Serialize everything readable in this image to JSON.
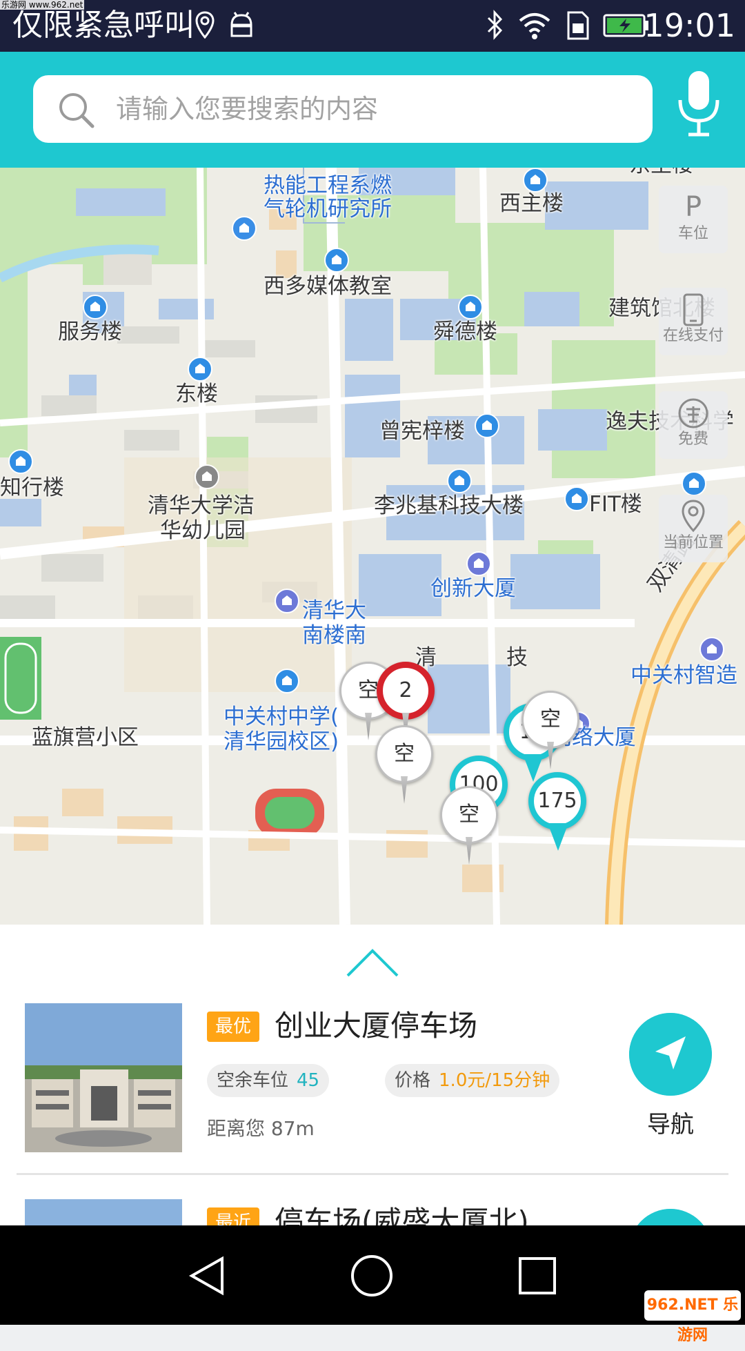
{
  "watermark": "乐游网 www.962.net",
  "status_bar": {
    "title": "仅限紧急呼叫",
    "time": "19:01",
    "icons": [
      "location-icon",
      "android-icon",
      "bluetooth-icon",
      "wifi-icon",
      "sim-icon",
      "battery-icon"
    ]
  },
  "search": {
    "placeholder": "请输入您要搜索的内容",
    "icon": "search-icon",
    "voice_icon": "microphone-icon"
  },
  "map": {
    "labels": [
      "热能工程系燃",
      "气轮机研究所",
      "西主楼",
      "东主楼",
      "西多媒体教室",
      "服务楼",
      "舜德楼",
      "建筑馆北楼",
      "东楼",
      "曾宪梓楼",
      "逸夫技术科学",
      "知行楼",
      "清华大学洁",
      "华幼儿园",
      "李兆基科技大楼",
      "FIT楼",
      "双清路",
      "创新大厦",
      "清华大",
      "南楼南",
      "中关村智造",
      "中关村中学(",
      "清华园校区)",
      "蓝旗营小区",
      "搜狐网络大厦",
      "清",
      "技"
    ],
    "side_buttons": [
      {
        "label": "车位",
        "icon": "parking-icon"
      },
      {
        "label": "在线支付",
        "icon": "phone-icon"
      },
      {
        "label": "免费",
        "icon": "free-icon"
      },
      {
        "label": "当前位置",
        "icon": "location-pin-icon"
      }
    ],
    "markers": [
      {
        "text": "空",
        "style": "gray"
      },
      {
        "text": "2",
        "style": "red"
      },
      {
        "text": "空",
        "style": "gray"
      },
      {
        "text": "19",
        "style": "teal"
      },
      {
        "text": "空",
        "style": "gray"
      },
      {
        "text": "100",
        "style": "teal"
      },
      {
        "text": "空",
        "style": "gray"
      },
      {
        "text": "175",
        "style": "teal"
      }
    ]
  },
  "panel": {
    "expand_icon": "chevron-up-icon",
    "cards": [
      {
        "badge": "最优",
        "name": "创业大厦停车场",
        "free_label": "空余车位",
        "free_value": "45",
        "price_label": "价格",
        "price_value": "1.0元/15分钟",
        "distance": "距离您 87m",
        "nav_label": "导航"
      },
      {
        "badge": "最近",
        "name": "停车场(威盛大厦北)"
      }
    ]
  },
  "navbar": {
    "buttons": [
      "back-icon",
      "home-icon",
      "recents-icon"
    ],
    "brand": "962.NET 乐游网"
  },
  "colors": {
    "accent": "#1ec8d0",
    "status_bar": "#1b1f3b",
    "badge": "#ffa415",
    "price": "#f29a0d",
    "free_count": "#20b3bf",
    "marker_red": "#d5232c"
  }
}
